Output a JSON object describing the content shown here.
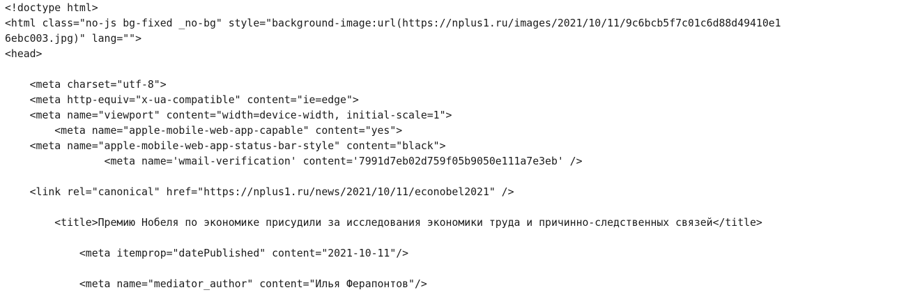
{
  "source": {
    "lines": [
      "<!doctype html>",
      "<html class=\"no-js bg-fixed _no-bg\" style=\"background-image:url(https://nplus1.ru/images/2021/10/11/9c6bcb5f7c01c6d88d49410e1",
      "6ebc003.jpg)\" lang=\"\">",
      "<head>",
      "",
      "    <meta charset=\"utf-8\">",
      "    <meta http-equiv=\"x-ua-compatible\" content=\"ie=edge\">",
      "    <meta name=\"viewport\" content=\"width=device-width, initial-scale=1\">",
      "        <meta name=\"apple-mobile-web-app-capable\" content=\"yes\">",
      "    <meta name=\"apple-mobile-web-app-status-bar-style\" content=\"black\">",
      "                <meta name='wmail-verification' content='7991d7eb02d759f05b9050e111a7e3eb' />",
      "",
      "    <link rel=\"canonical\" href=\"https://nplus1.ru/news/2021/10/11/econobel2021\" />",
      "",
      "        <title>Премию Нобеля по экономике присудили за исследования экономики труда и причинно-следственных связей</title>",
      "",
      "            <meta itemprop=\"datePublished\" content=\"2021-10-11\"/>",
      "",
      "            <meta name=\"mediator_author\" content=\"Илья Ферапонтов\"/>"
    ]
  }
}
